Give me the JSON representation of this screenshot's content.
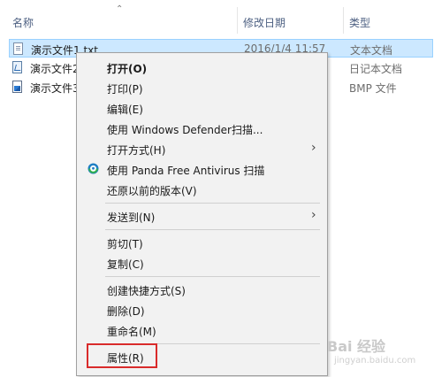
{
  "columns": {
    "name": "名称",
    "date": "修改日期",
    "type": "类型"
  },
  "files": [
    {
      "name": "演示文件1.txt",
      "date": "2016/1/4 11:57",
      "type": "文本文档",
      "icon": "text-file-icon",
      "selected": true
    },
    {
      "name": "演示文件2",
      "date": "",
      "type": "日记本文档",
      "icon": "journal-file-icon",
      "selected": false
    },
    {
      "name": "演示文件3",
      "date": "",
      "type": "BMP 文件",
      "icon": "bmp-file-icon",
      "selected": false
    }
  ],
  "menu": {
    "open": "打开(O)",
    "print": "打印(P)",
    "edit": "编辑(E)",
    "defender": "使用 Windows Defender扫描...",
    "open_with": "打开方式(H)",
    "panda": "使用 Panda Free Antivirus 扫描",
    "restore": "还原以前的版本(V)",
    "send_to": "发送到(N)",
    "cut": "剪切(T)",
    "copy": "复制(C)",
    "shortcut": "创建快捷方式(S)",
    "delete": "删除(D)",
    "rename": "重命名(M)",
    "properties": "属性(R)"
  },
  "watermark": {
    "main": "Bai 经验",
    "sub": "jingyan.baidu.com"
  },
  "colors": {
    "selection": "#cce8ff",
    "highlight_box": "#d92b2b"
  }
}
